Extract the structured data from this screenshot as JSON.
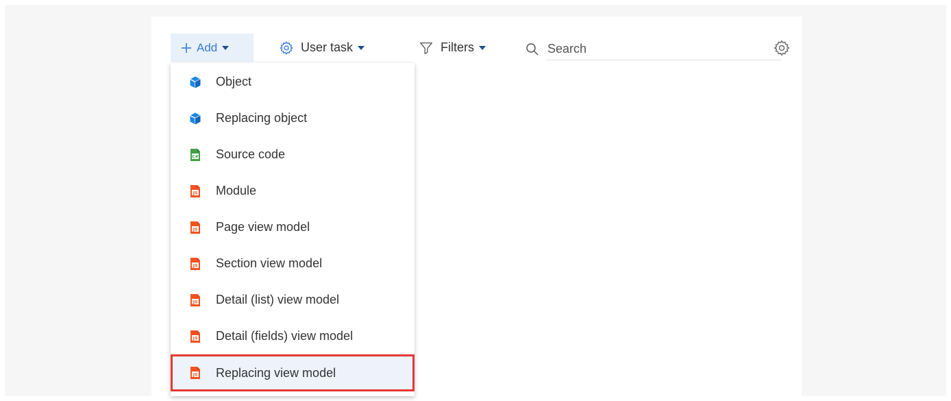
{
  "toolbar": {
    "add_label": "Add",
    "user_task_label": "User task",
    "filters_label": "Filters",
    "search_placeholder": "Search"
  },
  "menu": {
    "items": [
      {
        "label": "Object",
        "icon": "cube-icon"
      },
      {
        "label": "Replacing object",
        "icon": "cube-icon"
      },
      {
        "label": "Source code",
        "icon": "csharp-file-icon"
      },
      {
        "label": "Module",
        "icon": "js-file-icon"
      },
      {
        "label": "Page view model",
        "icon": "js-file-icon"
      },
      {
        "label": "Section view model",
        "icon": "js-file-icon"
      },
      {
        "label": "Detail (list) view model",
        "icon": "js-file-icon"
      },
      {
        "label": "Detail (fields) view model",
        "icon": "js-file-icon"
      },
      {
        "label": "Replacing view model",
        "icon": "js-file-icon"
      }
    ],
    "highlighted_item": "Replacing view model"
  },
  "colors": {
    "accent": "#3a7bd5",
    "highlight_border": "#e53935",
    "cube_icon": "#1e88e5",
    "csharp_icon": "#43a047",
    "js_icon": "#f4511e"
  }
}
